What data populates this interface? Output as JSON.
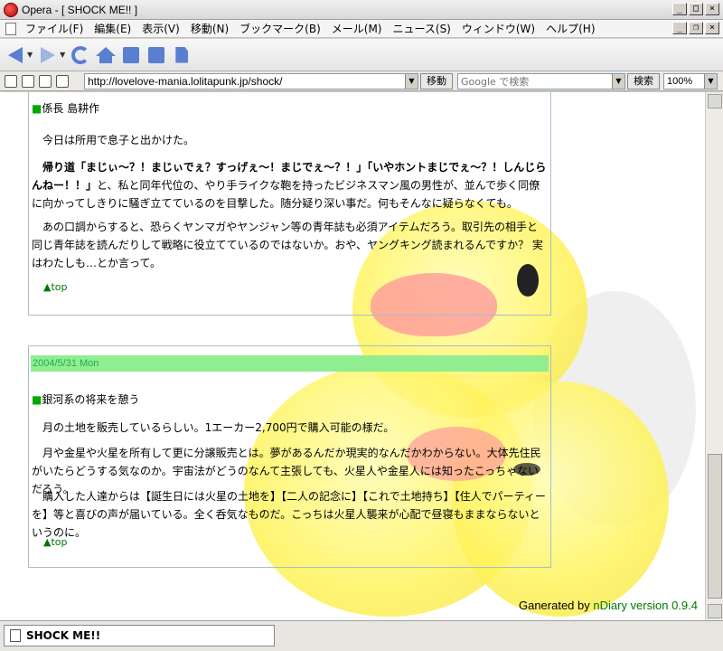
{
  "window": {
    "title": "Opera - [ SHOCK ME!! ]"
  },
  "menu": {
    "items": [
      "ファイル(F)",
      "編集(E)",
      "表示(V)",
      "移動(N)",
      "ブックマーク(B)",
      "メール(M)",
      "ニュース(S)",
      "ウィンドウ(W)",
      "ヘルプ(H)"
    ]
  },
  "address": {
    "url": "http://lovelove-mania.lolitapunk.jp/shock/",
    "go_label": "移動",
    "search_placeholder": "Google で検索",
    "search_label": "検索",
    "zoom": "100%"
  },
  "entry1": {
    "heading": "係長 島耕作",
    "p1": "今日は所用で息子と出かけた。",
    "p2_bold": "帰り道「まじぃ～？！まじぃでぇ？すっげぇ～！まじでぇ～？！」「いやホントまじでぇ～？！しんじらんねー！！」",
    "p2_rest": "と、私と同年代位の、やり手ライクな鞄を持ったビジネスマン風の男性が、並んで歩く同僚に向かってしきりに騒ぎ立てているのを目撃した。随分疑り深い事だ。何もそんなに疑らなくても。",
    "p3": "あの口調からすると、恐らくヤンマガやヤンジャン等の青年誌も必須アイテムだろう。取引先の相手と同じ青年誌を読んだりして戦略に役立てているのではないか。おや、ヤングキング読まれるんですか？ 実はわたしも…とか言って。",
    "top_label": "▲top"
  },
  "entry2": {
    "date": "2004/5/31 Mon",
    "heading": "銀河系の将来を憩う",
    "p1": "月の土地を販売しているらしい。1エーカー2,700円で購入可能の様だ。",
    "p2": "月や金星や火星を所有して更に分譲販売とは。夢があるんだか現実的なんだかわからない。大体先住民がいたらどうする気なのか。宇宙法がどうのなんて主張しても、火星人や金星人には知ったこっちゃないだろう。",
    "p3": "購入した人達からは【誕生日には火星の土地を】【二人の記念に】【これで土地持ち】【住人でパーティーを】等と喜びの声が届いている。全く呑気なものだ。こっちは火星人襲来が心配で昼寝もままならないというのに。",
    "top_label": "▲top"
  },
  "footer": {
    "generated_prefix": "Ganerated by ",
    "generated_link": "nDiary version 0.9.4"
  },
  "status": {
    "tab_label": "SHOCK ME!!"
  }
}
